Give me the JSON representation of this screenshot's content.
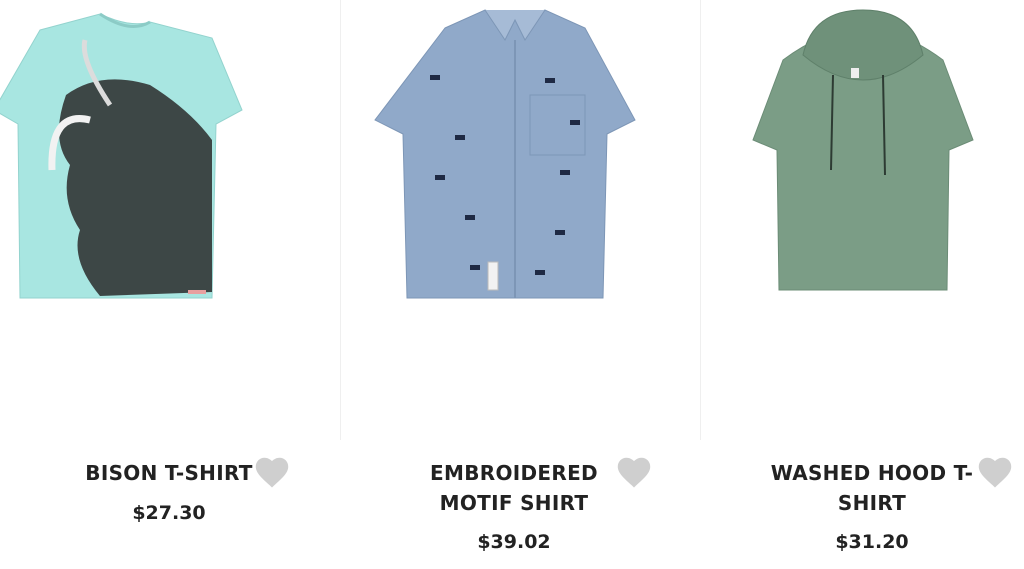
{
  "products": [
    {
      "name": "BISON T-SHIRT",
      "price": "$27.30",
      "image_icon": "bison-tshirt-image",
      "color": "#a7e6e0"
    },
    {
      "name": "EMBROIDERED MOTIF SHIRT",
      "name_line1": "EMBROIDERED",
      "name_line2": "MOTIF SHIRT",
      "price": "$39.02",
      "image_icon": "chambray-shirt-image",
      "color": "#8ea8c8"
    },
    {
      "name": "WASHED HOOD T-SHIRT",
      "name_line1": "WASHED HOOD T-",
      "name_line2": "SHIRT",
      "price": "$31.20",
      "image_icon": "hooded-tshirt-image",
      "color": "#7a9c84"
    }
  ],
  "wishlist_icon": "heart-icon",
  "wishlist_color": "#cfcfcf"
}
